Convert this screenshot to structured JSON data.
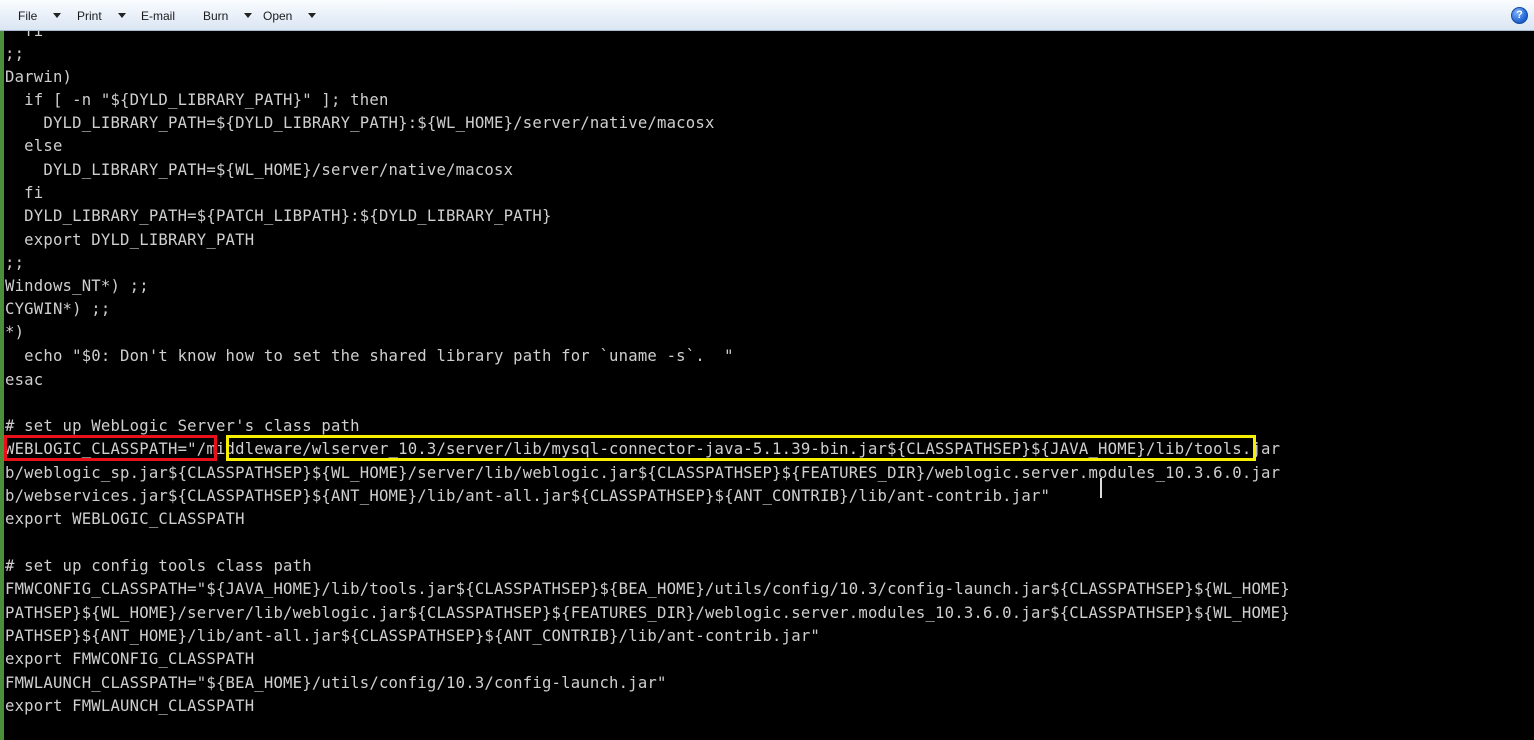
{
  "toolbar": {
    "menus": [
      {
        "label": "File",
        "has_dropdown": true
      },
      {
        "label": "Print",
        "has_dropdown": true
      },
      {
        "label": "E-mail",
        "has_dropdown": false
      },
      {
        "label": "Burn",
        "has_dropdown": true
      },
      {
        "label": "Open",
        "has_dropdown": true
      }
    ],
    "help_label": "?"
  },
  "terminal": {
    "lines": [
      "  fi",
      ";;",
      "Darwin)",
      "  if [ -n \"${DYLD_LIBRARY_PATH}\" ]; then",
      "    DYLD_LIBRARY_PATH=${DYLD_LIBRARY_PATH}:${WL_HOME}/server/native/macosx",
      "  else",
      "    DYLD_LIBRARY_PATH=${WL_HOME}/server/native/macosx",
      "  fi",
      "  DYLD_LIBRARY_PATH=${PATCH_LIBPATH}:${DYLD_LIBRARY_PATH}",
      "  export DYLD_LIBRARY_PATH",
      ";;",
      "Windows_NT*) ;;",
      "CYGWIN*) ;;",
      "*)",
      "  echo \"$0: Don't know how to set the shared library path for `uname -s`.  \"",
      "esac",
      "",
      "# set up WebLogic Server's class path",
      "WEBLOGIC_CLASSPATH=\"/middleware/wlserver_10.3/server/lib/mysql-connector-java-5.1.39-bin.jar${CLASSPATHSEP}${JAVA_HOME}/lib/tools.jar",
      "b/weblogic_sp.jar${CLASSPATHSEP}${WL_HOME}/server/lib/weblogic.jar${CLASSPATHSEP}${FEATURES_DIR}/weblogic.server.modules_10.3.6.0.jar",
      "b/webservices.jar${CLASSPATHSEP}${ANT_HOME}/lib/ant-all.jar${CLASSPATHSEP}${ANT_CONTRIB}/lib/ant-contrib.jar\"",
      "export WEBLOGIC_CLASSPATH",
      "",
      "# set up config tools class path",
      "FMWCONFIG_CLASSPATH=\"${JAVA_HOME}/lib/tools.jar${CLASSPATHSEP}${BEA_HOME}/utils/config/10.3/config-launch.jar${CLASSPATHSEP}${WL_HOME}",
      "PATHSEP}${WL_HOME}/server/lib/weblogic.jar${CLASSPATHSEP}${FEATURES_DIR}/weblogic.server.modules_10.3.6.0.jar${CLASSPATHSEP}${WL_HOME}",
      "PATHSEP}${ANT_HOME}/lib/ant-all.jar${CLASSPATHSEP}${ANT_CONTRIB}/lib/ant-contrib.jar\"",
      "export FMWCONFIG_CLASSPATH",
      "FMWLAUNCH_CLASSPATH=\"${BEA_HOME}/utils/config/10.3/config-launch.jar\"",
      "export FMWLAUNCH_CLASSPATH"
    ]
  },
  "colors": {
    "highlight_red": "#e8101a",
    "highlight_yellow": "#f6f000",
    "terminal_text": "#cfcfcf",
    "terminal_bg": "#000000"
  }
}
